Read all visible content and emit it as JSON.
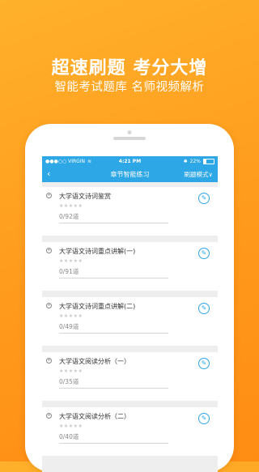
{
  "hero": {
    "title": "超速刷题 考分大增",
    "subtitle": "智能考试题库 名师视频解析"
  },
  "statusbar": {
    "carrier": "●●●○○ VIRGIN",
    "wifi_icon": "wifi-icon",
    "time": "4:21 PM",
    "bluetooth": "✱",
    "battery": "22%"
  },
  "navbar": {
    "back": "‹",
    "title": "章节智能练习",
    "mode": "刷题模式∨"
  },
  "items": [
    {
      "title": "大学语文诗词鉴赏",
      "stars": "★★★★★",
      "count": "0/92道"
    },
    {
      "title": "大学语文诗词重点讲解(一)",
      "stars": "★★★★★",
      "count": "0/91道"
    },
    {
      "title": "大学语文诗词重点讲解(二)",
      "stars": "★★★★★",
      "count": "0/49道"
    },
    {
      "title": "大学语文阅读分析（一）",
      "stars": "★★★★★",
      "count": "0/35道"
    },
    {
      "title": "大学语文阅读分析（二）",
      "stars": "★★★★★",
      "count": "0/40道"
    }
  ],
  "colors": {
    "background": "#ff9d1f",
    "accent": "#2ea7e6"
  }
}
